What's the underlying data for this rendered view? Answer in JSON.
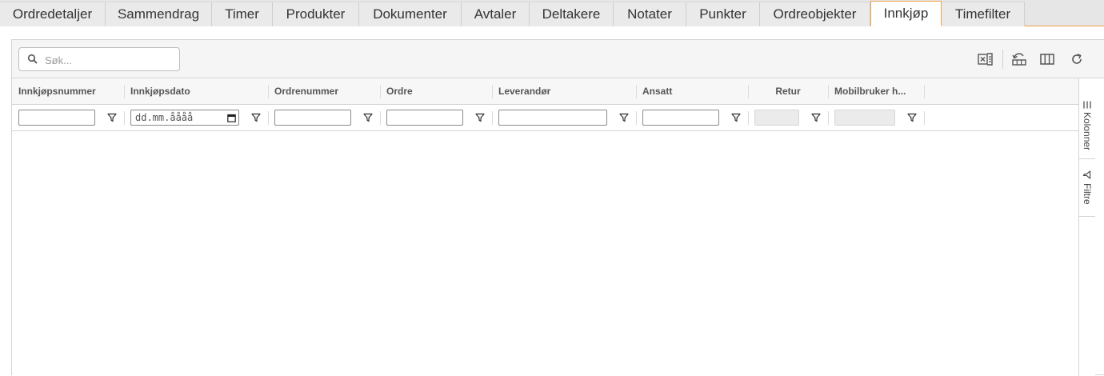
{
  "tabs": [
    {
      "label": "Ordredetaljer"
    },
    {
      "label": "Sammendrag"
    },
    {
      "label": "Timer"
    },
    {
      "label": "Produkter"
    },
    {
      "label": "Dokumenter"
    },
    {
      "label": "Avtaler"
    },
    {
      "label": "Deltakere"
    },
    {
      "label": "Notater"
    },
    {
      "label": "Punkter"
    },
    {
      "label": "Ordreobjekter"
    },
    {
      "label": "Innkjøp"
    },
    {
      "label": "Timefilter"
    }
  ],
  "active_tab": "Innkjøp",
  "search": {
    "placeholder": "Søk...",
    "value": ""
  },
  "toolbar_icons": [
    "excel-export-icon",
    "reset-layout-icon",
    "columns-icon",
    "refresh-icon"
  ],
  "columns": [
    {
      "label": "Innkjøpsnummer"
    },
    {
      "label": "Innkjøpsdato"
    },
    {
      "label": "Ordrenummer"
    },
    {
      "label": "Ordre"
    },
    {
      "label": "Leverandør"
    },
    {
      "label": "Ansatt"
    },
    {
      "label": "Retur"
    },
    {
      "label": "Mobilbruker h..."
    }
  ],
  "filters": {
    "date_placeholder": "dd.mm.åååå"
  },
  "side_panel": {
    "columns_label": "Kolonner",
    "filters_label": "Filtre"
  },
  "colors": {
    "accent": "#f0a04b"
  }
}
